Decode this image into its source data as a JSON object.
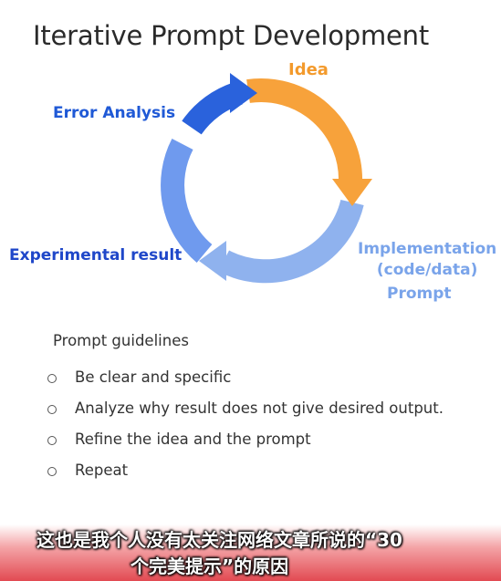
{
  "title": "Iterative Prompt Development",
  "cycle": {
    "idea": "Idea",
    "implementation_line1": "Implementation",
    "implementation_line2": "(code/data)",
    "implementation_prompt": "Prompt",
    "experimental_result": "Experimental result",
    "error_analysis": "Error Analysis",
    "colors": {
      "orange": "#f7a23b",
      "light_blue": "#8fb2ee",
      "mid_blue": "#5b8cea",
      "dark_blue": "#2a62dc"
    }
  },
  "guidelines": {
    "heading": "Prompt guidelines",
    "items": [
      "Be clear and specific",
      "Analyze why result does not give desired output.",
      "Refine the idea and the prompt",
      "Repeat"
    ]
  },
  "caption": {
    "line1": "这也是我个人没有太关注网络文章所说的“30",
    "line2": "个完美提示”的原因"
  }
}
